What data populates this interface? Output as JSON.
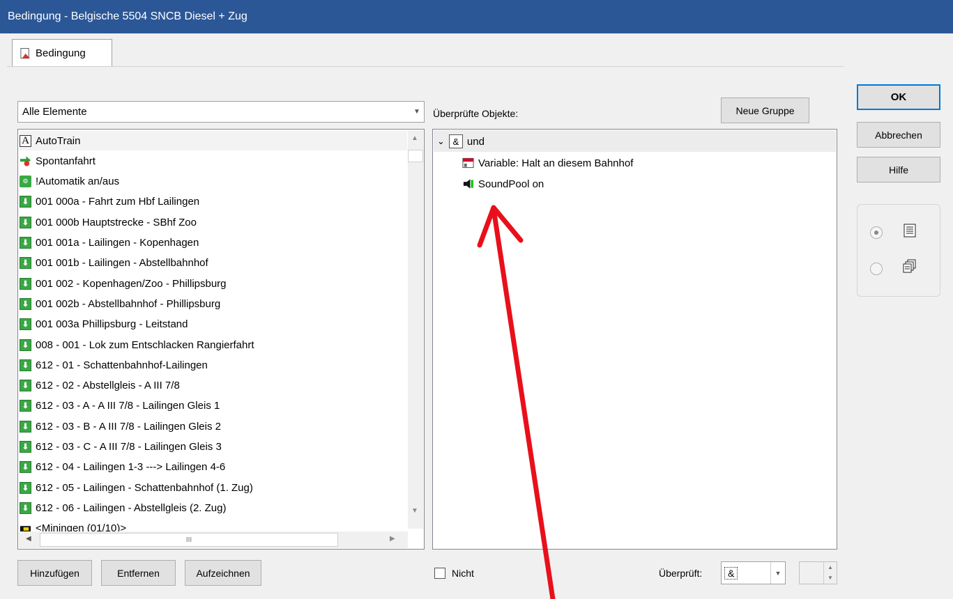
{
  "window": {
    "title": "Bedingung - Belgische 5504 SNCB Diesel + Zug"
  },
  "tab": {
    "label": "Bedingung"
  },
  "filter": {
    "selected": "Alle Elemente"
  },
  "element_list": {
    "items": [
      {
        "label": "AutoTrain",
        "icon": "letter-a-icon"
      },
      {
        "label": "Spontanfahrt",
        "icon": "spontanfahrt-icon"
      },
      {
        "label": "!Automatik an/aus",
        "icon": "automatik-icon"
      },
      {
        "label": "001 000a - Fahrt zum Hbf Lailingen",
        "icon": "route-arrow-icon"
      },
      {
        "label": "001 000b Hauptstrecke - SBhf Zoo",
        "icon": "route-arrow-icon"
      },
      {
        "label": "001 001a - Lailingen - Kopenhagen",
        "icon": "route-arrow-icon"
      },
      {
        "label": "001 001b - Lailingen - Abstellbahnhof",
        "icon": "route-arrow-icon"
      },
      {
        "label": "001 002 - Kopenhagen/Zoo - Phillipsburg",
        "icon": "route-arrow-icon"
      },
      {
        "label": "001 002b - Abstellbahnhof - Phillipsburg",
        "icon": "route-arrow-icon"
      },
      {
        "label": "001 003a Phillipsburg - Leitstand",
        "icon": "route-arrow-icon"
      },
      {
        "label": "008 - 001 - Lok zum Entschlacken Rangierfahrt",
        "icon": "route-arrow-icon"
      },
      {
        "label": "612 - 01 - Schattenbahnhof-Lailingen",
        "icon": "route-arrow-icon"
      },
      {
        "label": "612 - 02 - Abstellgleis - A III 7/8",
        "icon": "route-arrow-icon"
      },
      {
        "label": "612 - 03 - A - A III 7/8 - Lailingen Gleis 1",
        "icon": "route-arrow-icon"
      },
      {
        "label": "612 - 03 - B - A III 7/8 - Lailingen Gleis 2",
        "icon": "route-arrow-icon"
      },
      {
        "label": "612 - 03 - C - A III 7/8 - Lailingen Gleis 3",
        "icon": "route-arrow-icon"
      },
      {
        "label": "612 - 04 - Lailingen 1-3 ---> Lailingen 4-6",
        "icon": "route-arrow-icon"
      },
      {
        "label": "612 - 05 - Lailingen - Schattenbahnhof (1. Zug)",
        "icon": "route-arrow-icon"
      },
      {
        "label": "612 - 06 - Lailingen - Abstellgleis (2. Zug)",
        "icon": "route-arrow-icon"
      },
      {
        "label": "<Miningen (01/10)>",
        "icon": "block-icon"
      }
    ],
    "hscroll_grip": "III"
  },
  "checked_objects": {
    "label": "Überprüfte Objekte:",
    "root": {
      "symbol": "&",
      "label": "und"
    },
    "children": [
      {
        "label": "Variable: Halt an diesem Bahnhof",
        "icon": "variable-icon"
      },
      {
        "label": "SoundPool on",
        "icon": "speaker-icon"
      }
    ]
  },
  "buttons": {
    "new_group": "Neue Gruppe",
    "ok": "OK",
    "cancel": "Abbrechen",
    "help": "Hilfe",
    "add": "Hinzufügen",
    "remove": "Entfernen",
    "record": "Aufzeichnen"
  },
  "bottom": {
    "not_label": "Nicht",
    "checked_label": "Überprüft:",
    "operator": "&"
  },
  "colors": {
    "titlebar": "#2b5797",
    "arrow": "#e8101a",
    "route_icon": "#3aa845"
  }
}
